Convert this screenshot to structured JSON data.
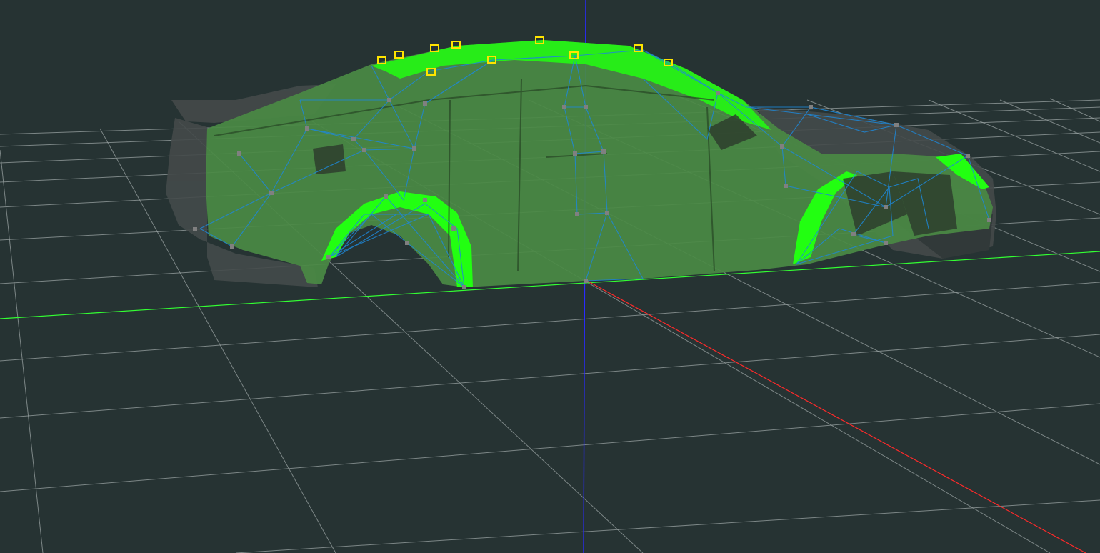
{
  "viewport": {
    "background_color": "#263333",
    "grid_color": "#9aa3a3",
    "x_axis_color": "#ff2a2a",
    "y_axis_color": "#2a2aff",
    "z_axis_color": "#33ff33",
    "body_mesh_color": "#4a8a44",
    "highlight_color": "#22ff11",
    "shadow_mesh_color": "#444a4a",
    "wireframe_color": "#1e88d8",
    "selected_vertex_color": "#ffe400",
    "vertex_color": "#808080",
    "model": "car-body",
    "grid": true
  }
}
